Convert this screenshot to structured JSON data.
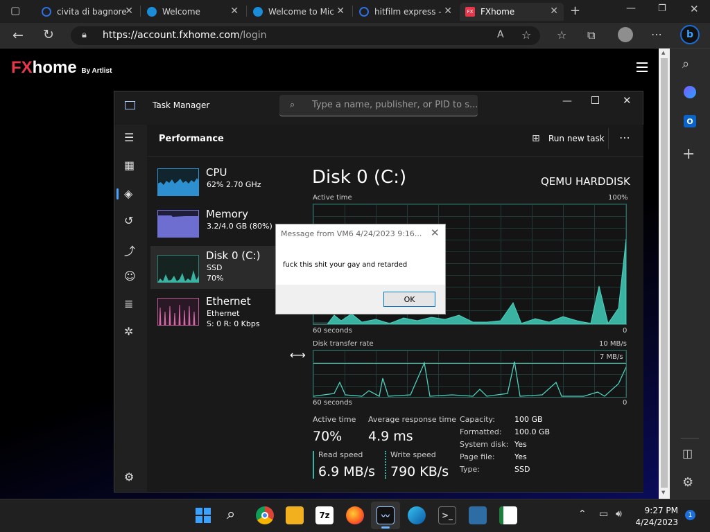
{
  "browser": {
    "tabs": [
      {
        "label": "civita di bagnore",
        "color": "#2f6fe0"
      },
      {
        "label": "Welcome",
        "color": "#1b8cd8"
      },
      {
        "label": "Welcome to Mic",
        "color": "#1b8cd8"
      },
      {
        "label": "hitfilm express -",
        "color": "#2f6fe0"
      },
      {
        "label": "FXhome",
        "color": "#e8374b",
        "active": true
      }
    ],
    "url_domain": "https://account.fxhome.com",
    "url_path": "/login"
  },
  "page": {
    "logo_fx": "FX",
    "logo_home": "home",
    "logo_by": "By Artlist"
  },
  "taskmanager": {
    "title": "Task Manager",
    "search_placeholder": "Type a name, publisher, or PID to s...",
    "section": "Performance",
    "run_new_task": "Run new task",
    "resources": [
      {
        "name": "CPU",
        "line1": "62% 2.70 GHz",
        "line2": ""
      },
      {
        "name": "Memory",
        "line1": "3.2/4.0 GB (80%)",
        "line2": ""
      },
      {
        "name": "Disk 0 (C:)",
        "line1": "SSD",
        "line2": "70%"
      },
      {
        "name": "Ethernet",
        "line1": "Ethernet",
        "line2": "S: 0 R: 0 Kbps"
      }
    ],
    "disk_title": "Disk 0 (C:)",
    "disk_model": "QEMU HARDDISK",
    "active_time_label": "Active time",
    "active_time_max": "100%",
    "seconds_label": "60 seconds",
    "zero": "0",
    "transfer_label": "Disk transfer rate",
    "transfer_max": "10 MB/s",
    "transfer_line": "7 MB/s",
    "stats": {
      "active_time_label": "Active time",
      "active_time": "70%",
      "avg_resp_label": "Average response time",
      "avg_resp": "4.9 ms",
      "read_label": "Read speed",
      "read": "6.9 MB/s",
      "write_label": "Write speed",
      "write": "790 KB/s"
    },
    "props": [
      {
        "label": "Capacity:",
        "value": "100 GB"
      },
      {
        "label": "Formatted:",
        "value": "100.0 GB"
      },
      {
        "label": "System disk:",
        "value": "Yes"
      },
      {
        "label": "Page file:",
        "value": "Yes"
      },
      {
        "label": "Type:",
        "value": "SSD"
      }
    ]
  },
  "dialog": {
    "title": "Message from VM6 4/24/2023 9:16...",
    "message": "fuck this shit your gay and retarded",
    "ok": "OK"
  },
  "taskbar": {
    "time": "9:27 PM",
    "date": "4/24/2023",
    "notifications": "1",
    "app_7z": "7z"
  },
  "colors": {
    "disk_green": "#3bb3a3",
    "cpu_blue": "#2d8fd0",
    "mem_purple": "#7a7ad6",
    "eth_pink": "#d36ba6",
    "brand_red": "#e8374b"
  }
}
